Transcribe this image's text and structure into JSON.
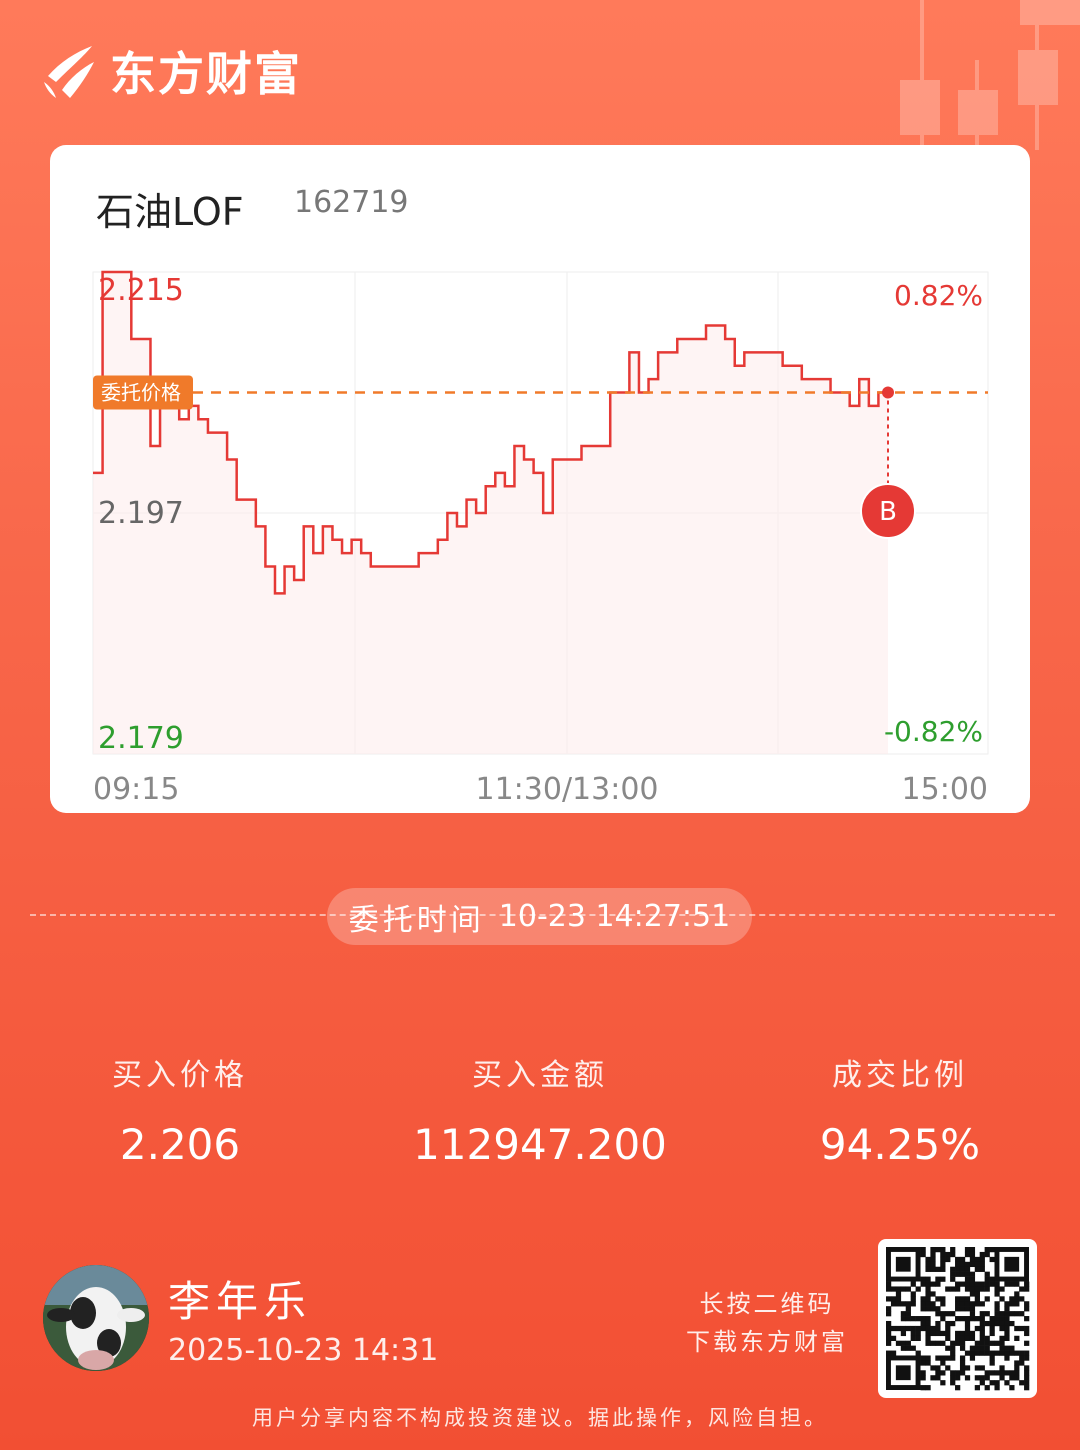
{
  "brand": {
    "name": "东方财富",
    "logo_icon": "eastmoney-logo-icon"
  },
  "stock": {
    "name": "石油LOF",
    "code": "162719"
  },
  "chart_data": {
    "type": "line",
    "y_labels": {
      "top": "2.215",
      "mid": "2.197",
      "bottom": "2.179"
    },
    "pct_labels": {
      "top": "0.82%",
      "bottom": "-0.82%"
    },
    "x_labels": [
      "09:15",
      "11:30/13:00",
      "15:00"
    ],
    "ylim": [
      2.179,
      2.215
    ],
    "order_price_label": "委托价格",
    "order_price": 2.206,
    "buy_marker": "B",
    "colors": {
      "line": "#e53935",
      "up": "#e53935",
      "down": "#2e9e2e",
      "order": "#f07a2a"
    },
    "series": [
      {
        "values": [
          2.2,
          2.215,
          2.215,
          2.215,
          2.21,
          2.21,
          2.202,
          2.207,
          2.205,
          2.204,
          2.205,
          2.204,
          2.203,
          2.203,
          2.201,
          2.198,
          2.198,
          2.196,
          2.193,
          2.191,
          2.193,
          2.192,
          2.196,
          2.194,
          2.196,
          2.195,
          2.194,
          2.195,
          2.194,
          2.193,
          2.193,
          2.193,
          2.193,
          2.193,
          2.194,
          2.194,
          2.195,
          2.197,
          2.196,
          2.198,
          2.197,
          2.199,
          2.2,
          2.199,
          2.202,
          2.201,
          2.2,
          2.197,
          2.201,
          2.201,
          2.201,
          2.202,
          2.202,
          2.202,
          2.206,
          2.206,
          2.209,
          2.206,
          2.207,
          2.209,
          2.209,
          2.21,
          2.21,
          2.21,
          2.211,
          2.211,
          2.21,
          2.208,
          2.209,
          2.209,
          2.209,
          2.209,
          2.208,
          2.208,
          2.207,
          2.207,
          2.207,
          2.206,
          2.206,
          2.205,
          2.207,
          2.205,
          2.206,
          2.206
        ]
      }
    ]
  },
  "order_time": {
    "label": "委托时间",
    "value": "10-23 14:27:51"
  },
  "stats": [
    {
      "label": "买入价格",
      "value": "2.206"
    },
    {
      "label": "买入金额",
      "value": "112947.200"
    },
    {
      "label": "成交比例",
      "value": "94.25%"
    }
  ],
  "user": {
    "name": "李年乐",
    "time": "2025-10-23 14:31",
    "avatar_icon": "cow-avatar-icon"
  },
  "qr": {
    "hint_line1": "长按二维码",
    "hint_line2": "下载东方财富",
    "icon": "qr-code-icon"
  },
  "disclaimer": "用户分享内容不构成投资建议。据此操作，风险自担。"
}
